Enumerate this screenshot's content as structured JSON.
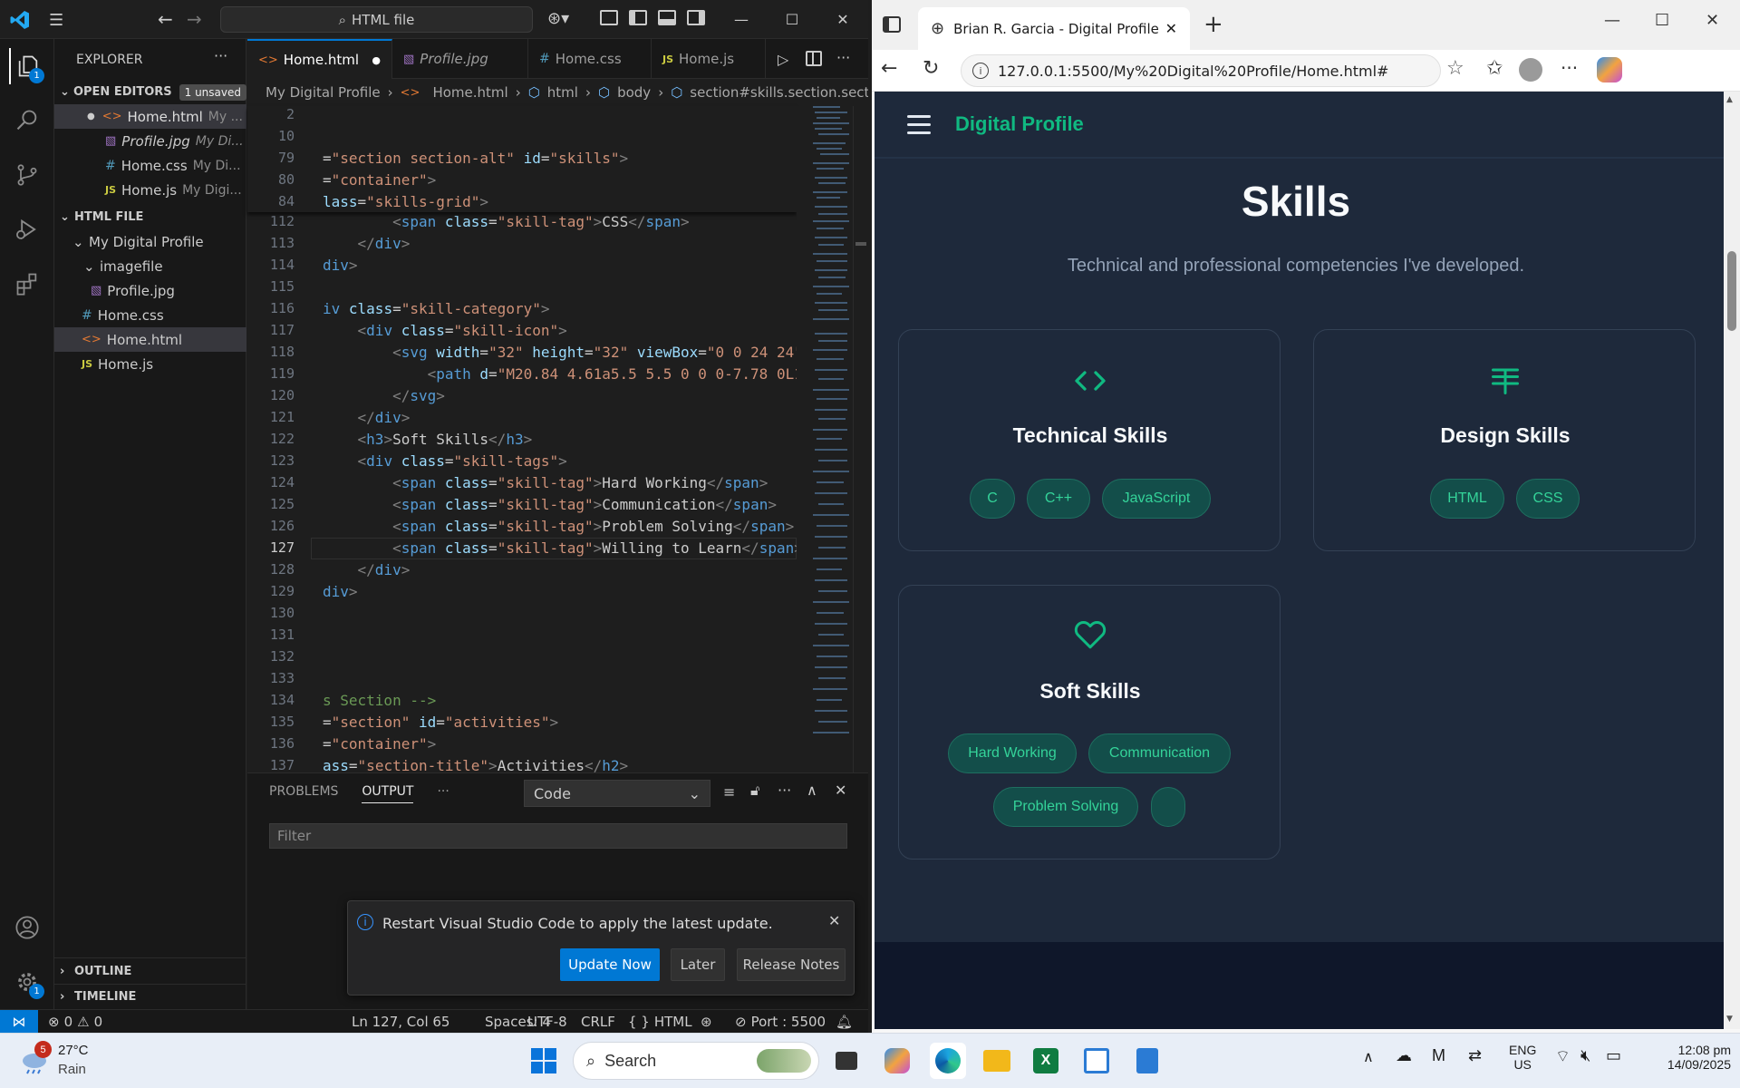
{
  "vscode": {
    "search": "HTML file",
    "activity_badges": {
      "explorer": "1",
      "settings": "1"
    },
    "sidebar": {
      "title": "EXPLORER",
      "open_editors": {
        "label": "OPEN EDITORS",
        "badge": "1 unsaved",
        "items": [
          {
            "name": "Home.html",
            "path": "My ..."
          },
          {
            "name": "Profile.jpg",
            "path": "My Di..."
          },
          {
            "name": "Home.css",
            "path": "My Di..."
          },
          {
            "name": "Home.js",
            "path": "My Digi..."
          }
        ]
      },
      "workspace": {
        "label": "HTML FILE",
        "folder": "My Digital Profile",
        "subfolder": "imagefile",
        "files": [
          "Profile.jpg",
          "Home.css",
          "Home.html",
          "Home.js"
        ]
      },
      "outline": "OUTLINE",
      "timeline": "TIMELINE"
    },
    "tabs": [
      "Home.html",
      "Profile.jpg",
      "Home.css",
      "Home.js"
    ],
    "breadcrumbs": [
      "My Digital Profile",
      "Home.html",
      "html",
      "body",
      "section#skills.section.section-a"
    ],
    "sticky_numbers": [
      "2",
      "10",
      "79",
      "80",
      "84"
    ],
    "line_numbers": [
      "112",
      "113",
      "114",
      "115",
      "116",
      "117",
      "118",
      "119",
      "120",
      "121",
      "122",
      "123",
      "124",
      "125",
      "126",
      "127",
      "128",
      "129",
      "130",
      "131",
      "132",
      "133",
      "134",
      "135",
      "136",
      "137"
    ],
    "current_line": "127",
    "panel": {
      "tabs": [
        "PROBLEMS",
        "OUTPUT"
      ],
      "dropdown": "Code",
      "filter_placeholder": "Filter"
    },
    "notification": {
      "message": "Restart Visual Studio Code to apply the latest update.",
      "buttons": [
        "Update Now",
        "Later",
        "Release Notes"
      ]
    },
    "status": {
      "errors": "0",
      "warnings": "0",
      "position": "Ln 127, Col 65",
      "spaces": "Spaces: 4",
      "encoding": "UTF-8",
      "eol": "CRLF",
      "language": "HTML",
      "port": "Port : 5500"
    }
  },
  "browser": {
    "tab_title": "Brian R. Garcia - Digital Profile",
    "url": "127.0.0.1:5500/My%20Digital%20Profile/Home.html#",
    "page": {
      "brand": "Digital Profile",
      "title": "Skills",
      "subtitle": "Technical and professional competencies I've developed.",
      "cards": [
        {
          "title": "Technical Skills",
          "icon": "code-icon",
          "tags": [
            "C",
            "C++",
            "JavaScript"
          ]
        },
        {
          "title": "Design Skills",
          "icon": "text-align-icon",
          "tags": [
            "HTML",
            "CSS"
          ]
        },
        {
          "title": "Soft Skills",
          "icon": "heart-icon",
          "tags": [
            "Hard Working",
            "Communication",
            "Problem Solving",
            ""
          ]
        }
      ]
    }
  },
  "taskbar": {
    "weather": {
      "temp": "27°C",
      "condition": "Rain",
      "badge": "5"
    },
    "search": "Search",
    "lang": {
      "line1": "ENG",
      "line2": "US"
    },
    "time": "12:08 pm",
    "date": "14/09/2025"
  }
}
